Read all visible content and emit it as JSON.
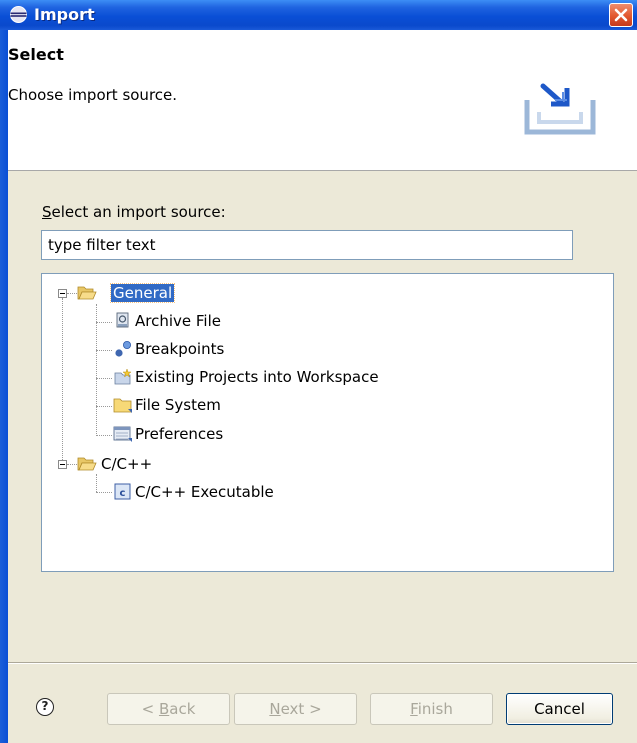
{
  "window": {
    "title": "Import"
  },
  "banner": {
    "title": "Select",
    "description": "Choose import source."
  },
  "main": {
    "source_label_prefix": "",
    "source_label_mnemonic": "S",
    "source_label_rest": "elect an import source:",
    "filter_value": "type filter text",
    "tree": {
      "general": {
        "label": "General",
        "children": [
          "Archive File",
          "Breakpoints",
          "Existing Projects into Workspace",
          "File System",
          "Preferences"
        ]
      },
      "cpp": {
        "label": "C/C++",
        "children": [
          "C/C++ Executable"
        ]
      }
    }
  },
  "footer": {
    "help_symbol": "?",
    "back_mnemonic": "B",
    "back_prefix": "< ",
    "back_rest": "ack",
    "next_mnemonic": "N",
    "next_rest": "ext >",
    "finish_mnemonic": "F",
    "finish_rest": "inish",
    "cancel_label": "Cancel"
  },
  "colors": {
    "titlebar": "#0a4fd6",
    "selection": "#316ac5",
    "dialog_bg": "#ece9d8",
    "close_button": "#e2582f"
  },
  "icons": {
    "title": "eclipse-icon",
    "close": "close-icon",
    "banner": "import-icon",
    "folder_open": "folder-open-icon",
    "archive": "archive-file-icon",
    "breakpoints": "breakpoints-icon",
    "existing_projects": "existing-projects-icon",
    "file_system": "folder-icon",
    "preferences": "preferences-icon",
    "executable": "cpp-executable-icon",
    "help": "help-icon"
  }
}
